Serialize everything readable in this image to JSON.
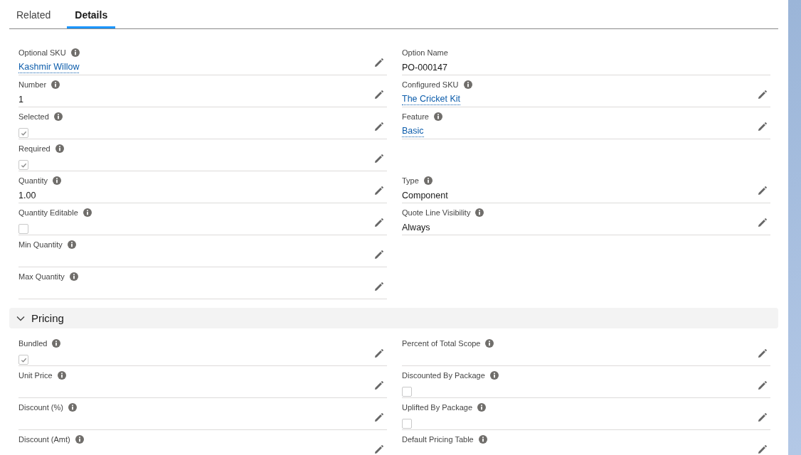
{
  "tabs": [
    {
      "label": "Related",
      "selected": false
    },
    {
      "label": "Details",
      "selected": true
    }
  ],
  "details": {
    "left": [
      {
        "kind": "link",
        "label": "Optional SKU",
        "value": "Kashmir Willow",
        "info": true,
        "editable": true
      },
      {
        "kind": "text",
        "label": "Number",
        "value": "1",
        "info": true,
        "editable": true
      },
      {
        "kind": "checkbox",
        "label": "Selected",
        "checked": true,
        "info": true,
        "editable": true
      },
      {
        "kind": "checkbox",
        "label": "Required",
        "checked": true,
        "info": true,
        "editable": true
      },
      {
        "kind": "text",
        "label": "Quantity",
        "value": "1.00",
        "info": true,
        "editable": true
      },
      {
        "kind": "checkbox",
        "label": "Quantity Editable",
        "checked": false,
        "info": true,
        "editable": true
      },
      {
        "kind": "text",
        "label": "Min Quantity",
        "info": true,
        "editable": true
      },
      {
        "kind": "text",
        "label": "Max Quantity",
        "info": true,
        "editable": true
      }
    ],
    "right": [
      {
        "kind": "text",
        "label": "Option Name",
        "value": "PO-000147",
        "info": false,
        "editable": false
      },
      {
        "kind": "link",
        "label": "Configured SKU",
        "value": "The Cricket Kit",
        "info": true,
        "editable": true
      },
      {
        "kind": "link",
        "label": "Feature",
        "value": "Basic",
        "info": true,
        "editable": true
      },
      {
        "kind": "blank"
      },
      {
        "kind": "text",
        "label": "Type",
        "value": "Component",
        "info": true,
        "editable": true
      },
      {
        "kind": "text",
        "label": "Quote Line Visibility",
        "value": "Always",
        "info": true,
        "editable": true
      }
    ]
  },
  "pricing": {
    "title": "Pricing",
    "expanded": true,
    "left": [
      {
        "kind": "checkbox",
        "label": "Bundled",
        "checked": true,
        "info": true,
        "editable": true
      },
      {
        "kind": "text",
        "label": "Unit Price",
        "info": true,
        "editable": true
      },
      {
        "kind": "text",
        "label": "Discount (%)",
        "info": true,
        "editable": true
      },
      {
        "kind": "text",
        "label": "Discount (Amt)",
        "info": true,
        "editable": true
      }
    ],
    "right": [
      {
        "kind": "text",
        "label": "Percent of Total Scope",
        "info": true,
        "editable": true
      },
      {
        "kind": "checkbox",
        "label": "Discounted By Package",
        "checked": false,
        "info": true,
        "editable": true
      },
      {
        "kind": "checkbox",
        "label": "Uplifted By Package",
        "checked": false,
        "info": true,
        "editable": true
      },
      {
        "kind": "text",
        "label": "Default Pricing Table",
        "info": true,
        "editable": true
      }
    ]
  }
}
